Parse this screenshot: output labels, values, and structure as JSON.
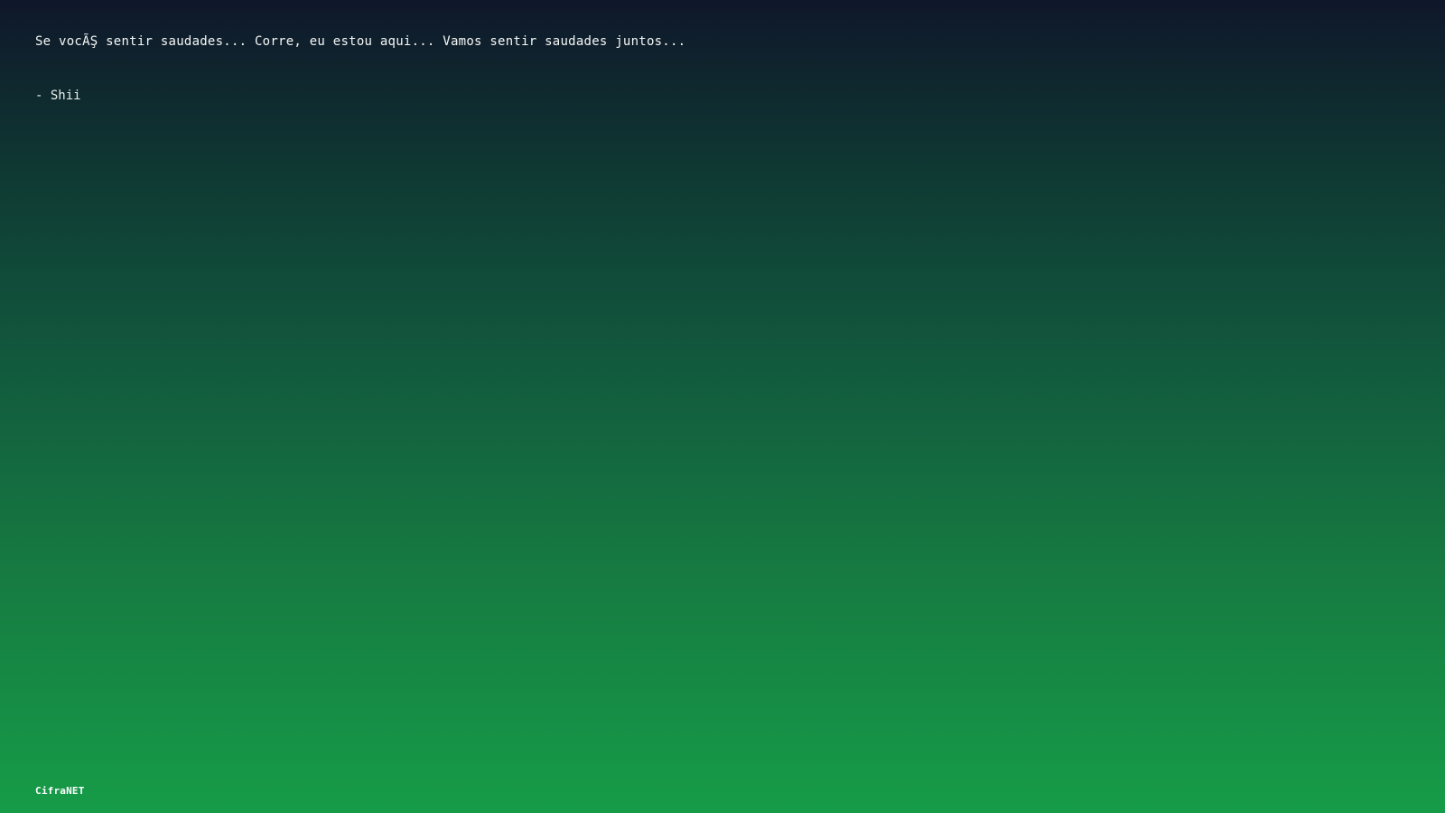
{
  "quote": {
    "text": "Se vocÃŞ sentir saudades... Corre, eu estou aqui... Vamos sentir saudades juntos...",
    "author": "- Shii"
  },
  "footer": {
    "brand": "CifraNET"
  },
  "colors": {
    "background_top": "#0f172a",
    "background_bottom": "#169c48",
    "text": "#f5f7f6"
  }
}
